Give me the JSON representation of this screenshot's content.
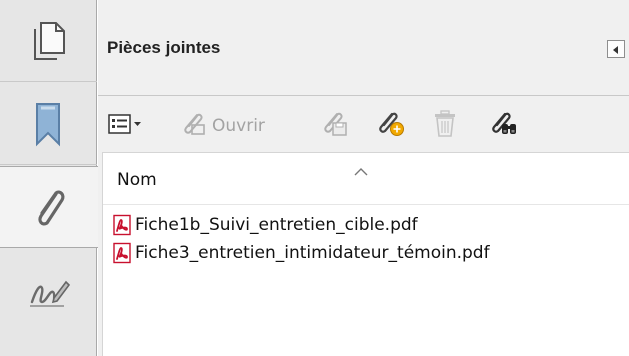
{
  "rail": {
    "items": [
      {
        "name": "pages-thumbnails",
        "selected": false
      },
      {
        "name": "bookmarks",
        "selected": false
      },
      {
        "name": "attachments",
        "selected": true
      },
      {
        "name": "signatures",
        "selected": false
      }
    ]
  },
  "panel": {
    "title": "Pièces jointes",
    "collapse_icon": "triangle-left-icon"
  },
  "toolbar": {
    "options_icon": "list-options-icon",
    "open_label": "Ouvrir",
    "open_icon": "paperclip-open-icon",
    "save_icon": "paperclip-save-icon",
    "add_icon": "paperclip-add-icon",
    "delete_icon": "trash-icon",
    "search_icon": "paperclip-search-icon"
  },
  "list": {
    "column_header": "Nom",
    "files": [
      {
        "name": "Fiche1b_Suivi_entretien_cible.pdf",
        "icon": "pdf-icon"
      },
      {
        "name": "Fiche3_entretien_intimidateur_témoin.pdf",
        "icon": "pdf-icon"
      }
    ]
  },
  "colors": {
    "pdf_red": "#c8102e",
    "disabled_gray": "#a3a3a3",
    "accent_yellow": "#f2a900"
  }
}
